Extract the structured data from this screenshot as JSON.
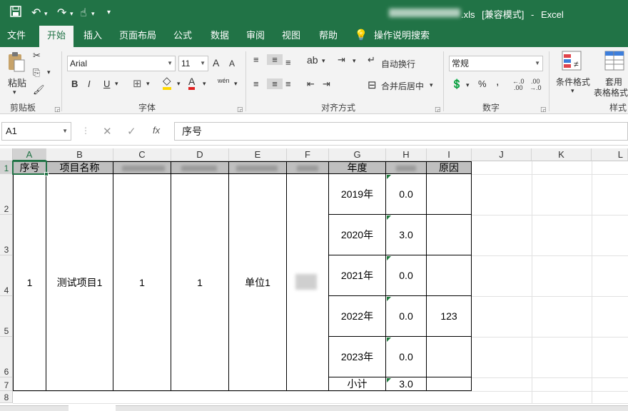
{
  "titlebar": {
    "filename": "xls",
    "mode": "[兼容模式]",
    "dash": "-",
    "app": "Excel",
    "save_icon": "save-icon",
    "undo_icon": "undo-icon",
    "redo_icon": "redo-icon",
    "touch_icon": "touch-mode-icon",
    "more_icon": "customize-quick-access-icon"
  },
  "tabs": [
    "文件",
    "开始",
    "插入",
    "页面布局",
    "公式",
    "数据",
    "审阅",
    "视图",
    "帮助",
    "操作说明搜索"
  ],
  "ribbon": {
    "clipboard": {
      "paste": "粘贴",
      "label": "剪贴板"
    },
    "font": {
      "name": "Arial",
      "size": "11",
      "bold": "B",
      "italic": "I",
      "underline": "U",
      "grow": "A",
      "shrink": "A",
      "phonetic": "wén",
      "label": "字体"
    },
    "alignment": {
      "wrap": "自动换行",
      "merge": "合并后居中",
      "label": "对齐方式"
    },
    "number": {
      "format": "常规",
      "percent": "%",
      "comma": ",",
      "label": "数字"
    },
    "styles": {
      "conditional": "条件格式",
      "table1": "套用",
      "table2": "表格格式",
      "label": "样式"
    }
  },
  "formula_bar": {
    "name_box": "A1",
    "cancel": "✕",
    "enter": "✓",
    "fx": "fx",
    "content": "序号"
  },
  "columns": [
    "A",
    "B",
    "C",
    "D",
    "E",
    "F",
    "G",
    "H",
    "I",
    "J",
    "K",
    "L"
  ],
  "rows": [
    "1",
    "2",
    "3",
    "4",
    "5",
    "6",
    "7",
    "8"
  ],
  "table": {
    "headers": {
      "A": "序号",
      "B": "项目名称",
      "G": "年度",
      "I": "原因"
    },
    "merged": {
      "A": "1",
      "B": "测试项目1",
      "C": "1",
      "D": "1",
      "E": "单位1"
    },
    "years": [
      {
        "year": "2019年",
        "value": "0.0",
        "reason": ""
      },
      {
        "year": "2020年",
        "value": "3.0",
        "reason": ""
      },
      {
        "year": "2021年",
        "value": "0.0",
        "reason": ""
      },
      {
        "year": "2022年",
        "value": "0.0",
        "reason": "123"
      },
      {
        "year": "2023年",
        "value": "0.0",
        "reason": ""
      }
    ],
    "subtotal": {
      "label": "小计",
      "value": "3.0"
    }
  }
}
